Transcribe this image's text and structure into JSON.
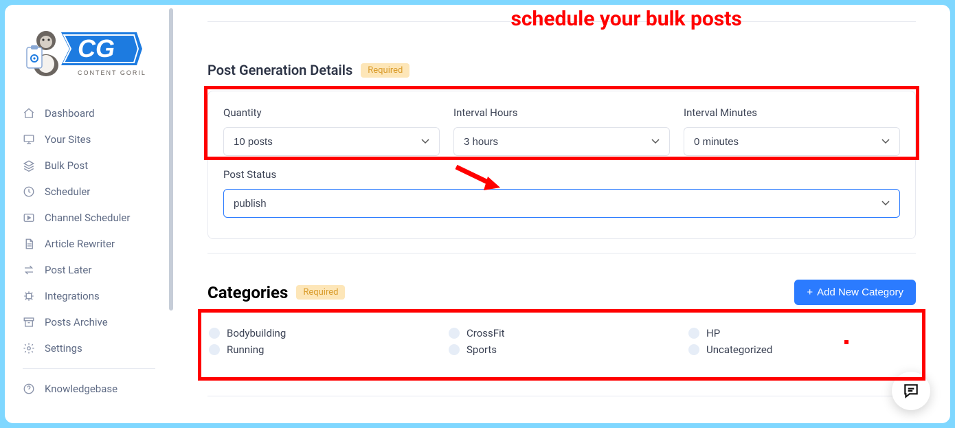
{
  "annotation": {
    "headline": "schedule your bulk posts"
  },
  "brand": {
    "name": "Content Gorilla"
  },
  "sidebar": {
    "items": [
      {
        "label": "Dashboard"
      },
      {
        "label": "Your Sites"
      },
      {
        "label": "Bulk Post"
      },
      {
        "label": "Scheduler"
      },
      {
        "label": "Channel Scheduler"
      },
      {
        "label": "Article Rewriter"
      },
      {
        "label": "Post Later"
      },
      {
        "label": "Integrations"
      },
      {
        "label": "Posts Archive"
      },
      {
        "label": "Settings"
      }
    ],
    "footer": {
      "label": "Knowledgebase"
    }
  },
  "postGen": {
    "title": "Post Generation Details",
    "required_badge": "Required",
    "quantity_label": "Quantity",
    "quantity_value": "10 posts",
    "interval_hours_label": "Interval Hours",
    "interval_hours_value": "3 hours",
    "interval_minutes_label": "Interval Minutes",
    "interval_minutes_value": "0 minutes",
    "post_status_label": "Post Status",
    "post_status_value": "publish"
  },
  "categories": {
    "title": "Categories",
    "required_badge": "Required",
    "add_button": "Add New Category",
    "items": [
      "Bodybuilding",
      "CrossFit",
      "HP",
      "Running",
      "Sports",
      "Uncategorized"
    ]
  }
}
